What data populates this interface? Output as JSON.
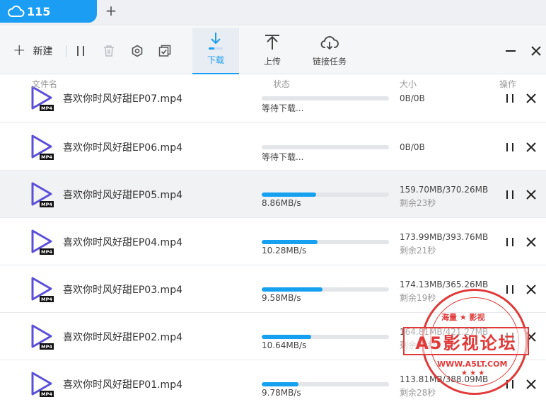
{
  "tab": {
    "title": "115",
    "add_label": "+"
  },
  "toolbar": {
    "new_label": "新建",
    "tabs": [
      {
        "label": "下载",
        "active": true
      },
      {
        "label": "上传",
        "active": false
      },
      {
        "label": "链接任务",
        "active": false
      }
    ]
  },
  "columns": {
    "name": "文件名",
    "status": "状态",
    "size": "大小",
    "action": "操作"
  },
  "tasks": [
    {
      "name": "喜欢你时风好甜EP07.mp4",
      "status": "等待下载...",
      "progress": 0,
      "size": "0B/0B",
      "remain": ""
    },
    {
      "name": "喜欢你时风好甜EP06.mp4",
      "status": "等待下载...",
      "progress": 0,
      "size": "0B/0B",
      "remain": ""
    },
    {
      "name": "喜欢你时风好甜EP05.mp4",
      "status": "8.86MB/s",
      "progress": 0.43,
      "size": "159.70MB/370.26MB",
      "remain": "剩余23秒"
    },
    {
      "name": "喜欢你时风好甜EP04.mp4",
      "status": "10.28MB/s",
      "progress": 0.44,
      "size": "173.99MB/393.76MB",
      "remain": "剩余21秒"
    },
    {
      "name": "喜欢你时风好甜EP03.mp4",
      "status": "9.58MB/s",
      "progress": 0.48,
      "size": "174.13MB/365.26MB",
      "remain": "剩余19秒"
    },
    {
      "name": "喜欢你时风好甜EP02.mp4",
      "status": "10.64MB/s",
      "progress": 0.39,
      "size": "164.81MB/421.27MB",
      "remain": "剩余25秒"
    },
    {
      "name": "喜欢你时风好甜EP01.mp4",
      "status": "9.78MB/s",
      "progress": 0.29,
      "size": "113.81MB/388.09MB",
      "remain": "剩余28秒"
    }
  ],
  "file_badge": "MP4",
  "watermark": {
    "main": "A5影视论坛",
    "top": "海量 ★ 影视",
    "url": "WWW.A5LT.COM",
    "stars": "★ ★ ★"
  },
  "colors": {
    "accent": "#1a9df2",
    "progress": "#16a1f0",
    "play_icon": "#5b4fd9",
    "stamp": "#e03a3a"
  }
}
